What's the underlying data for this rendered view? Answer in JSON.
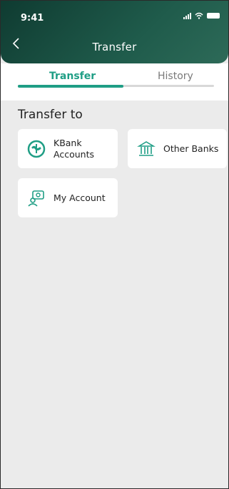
{
  "status": {
    "time": "9:41"
  },
  "header": {
    "title": "Transfer"
  },
  "tabs": [
    {
      "label": "Transfer",
      "active": true
    },
    {
      "label": "History",
      "active": false
    }
  ],
  "section": {
    "title": "Transfer to"
  },
  "options": [
    {
      "label": "KBank\nAccounts",
      "icon": "kbank-logo-icon"
    },
    {
      "label": "Other Banks",
      "icon": "bank-building-icon"
    },
    {
      "label": "My Account",
      "icon": "my-account-icon"
    }
  ],
  "colors": {
    "accent": "#1f9e85",
    "header": "#1f5b4b"
  }
}
